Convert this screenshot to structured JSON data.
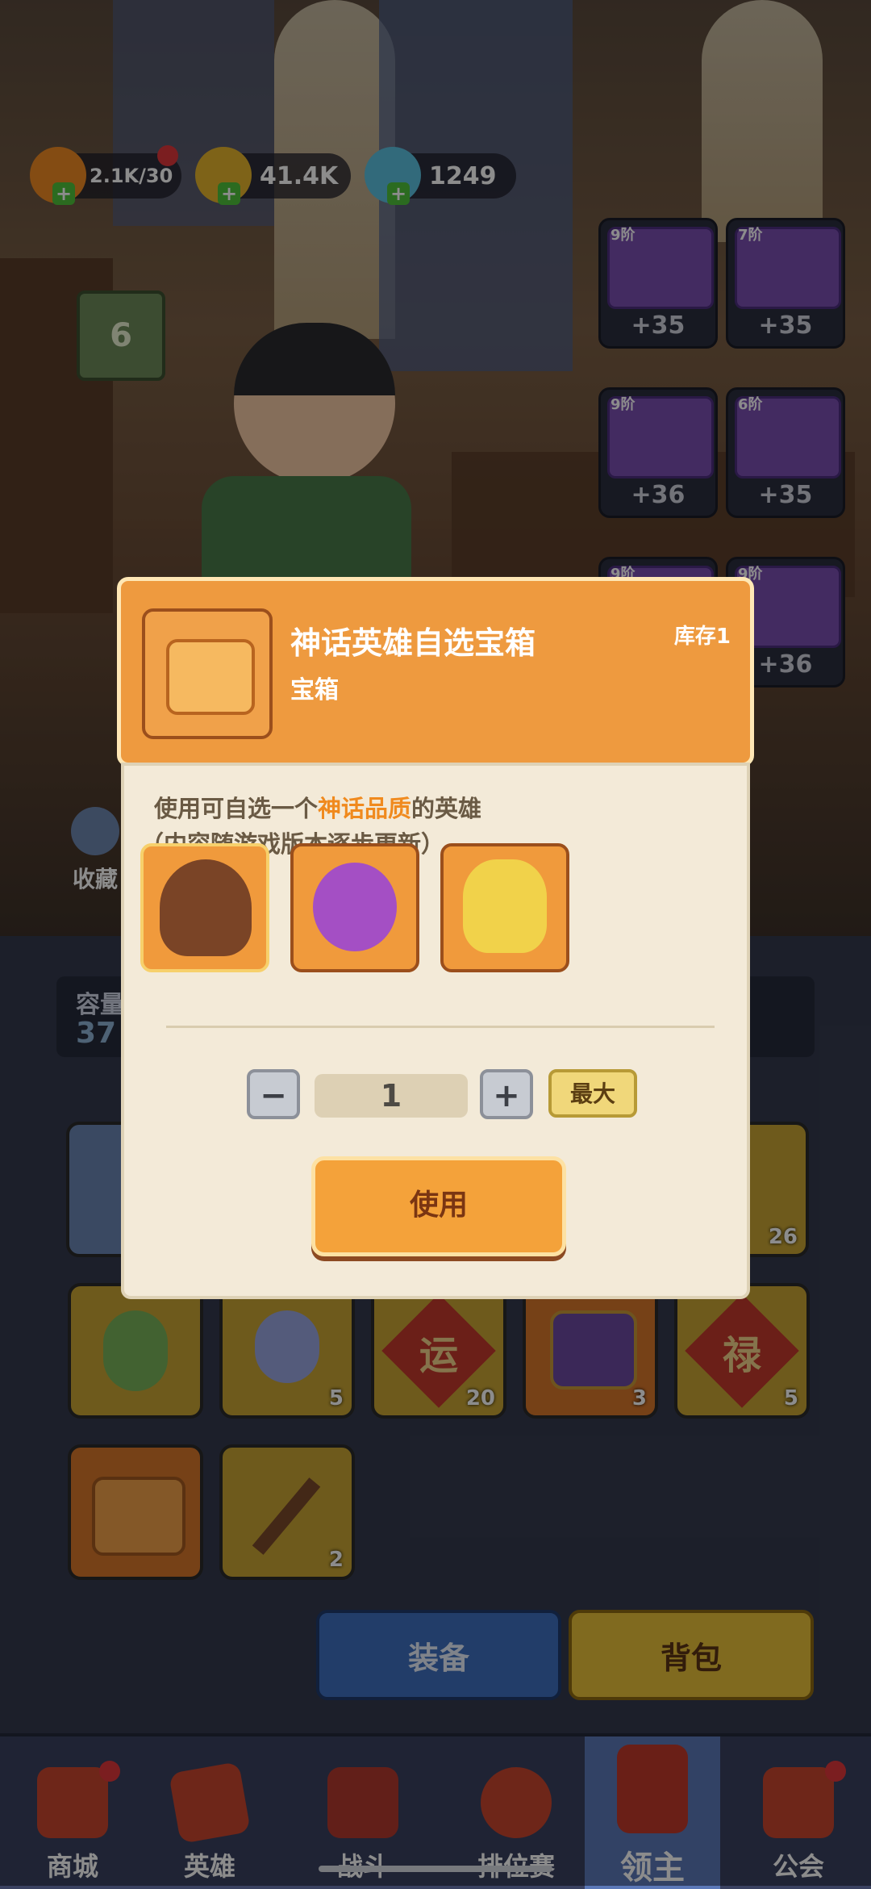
{
  "resources": {
    "energy": "2.1K/30",
    "coins": "41.4K",
    "gems": "1249"
  },
  "level": "6",
  "equipment": [
    {
      "tier": "9阶",
      "bonus": "+35",
      "icon": "helmet-icon"
    },
    {
      "tier": "7阶",
      "bonus": "+35",
      "icon": "armor-icon"
    },
    {
      "tier": "9阶",
      "bonus": "+36",
      "icon": "boots-icon"
    },
    {
      "tier": "6阶",
      "bonus": "+35",
      "icon": "gauntlet-icon"
    },
    {
      "tier": "9阶",
      "bonus": "",
      "icon": "ring-icon"
    },
    {
      "tier": "9阶",
      "bonus": "+36",
      "icon": "belt-icon"
    }
  ],
  "side": {
    "collect_label": "收藏",
    "capacity_label": "容量",
    "capacity_value": "37"
  },
  "modal": {
    "title": "神话英雄自选宝箱",
    "stock": "库存1",
    "subtitle": "宝箱",
    "desc_prefix": "使用可自选一个",
    "desc_highlight": "神话品质",
    "desc_suffix": "的英雄",
    "desc_note": "（内容随游戏版本逐步更新）",
    "quantity": "1",
    "minus": "−",
    "plus": "+",
    "max_label": "最大",
    "use_label": "使用",
    "heroes": [
      "brown-hair-girl-hero",
      "purple-flame-hero",
      "golden-lion-hero"
    ]
  },
  "inventory": {
    "row_right_count": "26",
    "items": [
      {
        "icon": "plant-icon",
        "count": ""
      },
      {
        "icon": "ghost-puzzle-icon",
        "count": "5"
      },
      {
        "icon": "luck-token-icon",
        "label": "运",
        "count": "20"
      },
      {
        "icon": "treasure-chest-icon",
        "count": "3"
      },
      {
        "icon": "fortune-token-icon",
        "label": "禄",
        "count": "5"
      },
      {
        "icon": "gold-chest-icon",
        "count": ""
      },
      {
        "icon": "pickaxe-icon",
        "count": "2"
      }
    ]
  },
  "tabs": {
    "equip_label": "装备",
    "bag_label": "背包"
  },
  "nav": [
    {
      "label": "商城",
      "icon": "shop-icon"
    },
    {
      "label": "英雄",
      "icon": "hero-icon"
    },
    {
      "label": "战斗",
      "icon": "battle-icon"
    },
    {
      "label": "排位赛",
      "icon": "ranking-icon"
    },
    {
      "label": "领主",
      "icon": "lord-icon"
    },
    {
      "label": "公会",
      "icon": "guild-icon"
    }
  ],
  "colors": {
    "modal_header": "#ee9a3f",
    "highlight": "#f08a1e",
    "use_button": "#f4a23a"
  }
}
